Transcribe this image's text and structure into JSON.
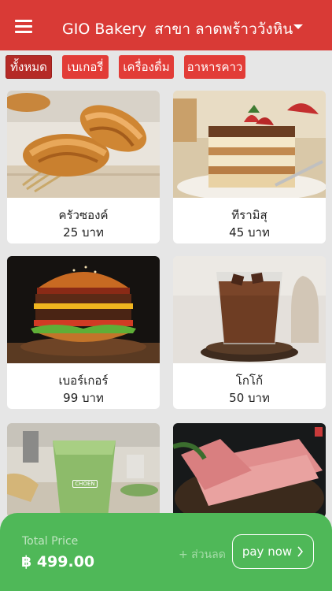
{
  "header": {
    "title": "GIO Bakery",
    "branch": "สาขา ลาดพร้าววังหิน",
    "menu_icon": "hamburger-menu-icon",
    "dropdown_icon": "caret-down-icon"
  },
  "categories": [
    {
      "label": "ทั้งหมด",
      "active": true
    },
    {
      "label": "เบเกอรี่",
      "active": false
    },
    {
      "label": "เครื่องดื่ม",
      "active": false
    },
    {
      "label": "อาหารคาว",
      "active": false
    }
  ],
  "products": [
    {
      "name": "ครัวซองค์",
      "price": "25 บาท"
    },
    {
      "name": "ทีรามิสุ",
      "price": "45 บาท"
    },
    {
      "name": "เบอร์เกอร์",
      "price": "99 บาท"
    },
    {
      "name": "โกโก้",
      "price": "50 บาท"
    },
    {
      "name": "",
      "price": "",
      "image_text": "CHOEN"
    },
    {
      "name": "",
      "price": ""
    }
  ],
  "paybar": {
    "total_label": "Total Price",
    "total_value": "฿ 499.00",
    "discount_label": "+ ส่วนลด",
    "pay_label": "pay now",
    "pay_icon": "chevron-right-icon"
  },
  "colors": {
    "header": "#d93a36",
    "chip": "#e23c37",
    "paybar": "#4fb858"
  }
}
